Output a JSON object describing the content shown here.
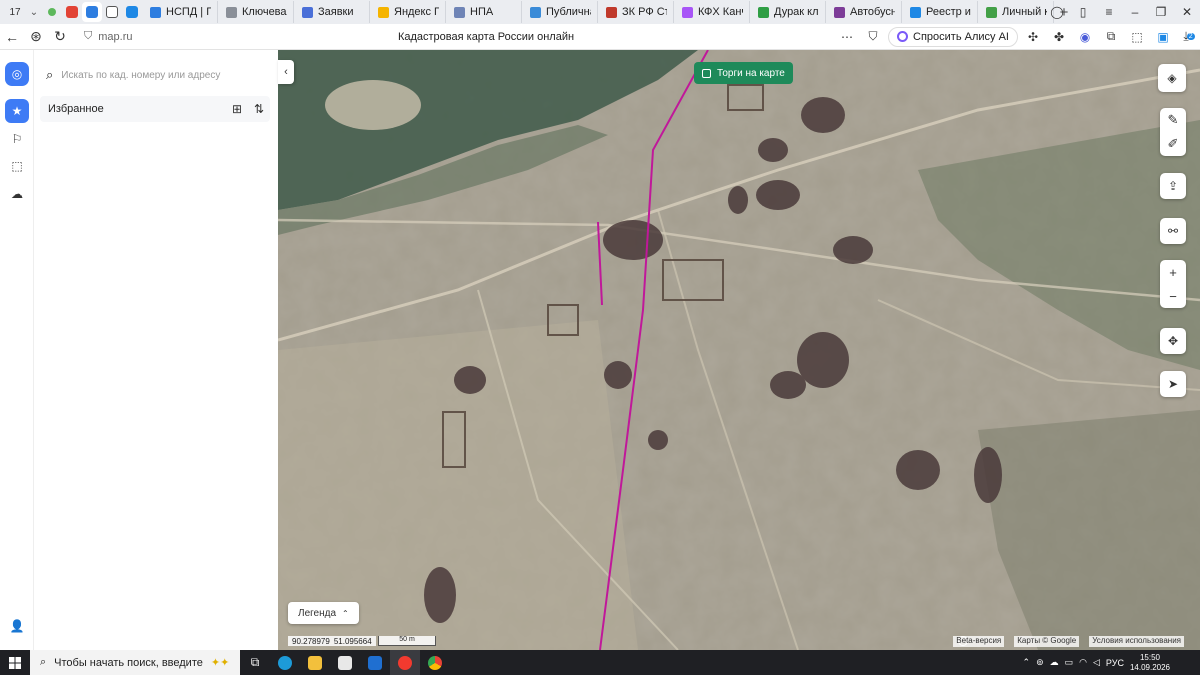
{
  "browser": {
    "tab_count": "17",
    "tabs": [
      {
        "title": "НСПД | Гео",
        "color": "#2d7de0"
      },
      {
        "title": "Ключевая с",
        "color": "#8a8f98"
      },
      {
        "title": "Заявки",
        "color": "#4a6fd8"
      },
      {
        "title": "Яндекс По",
        "color": "#f5b400"
      },
      {
        "title": "НПА",
        "color": "#6f84b6"
      },
      {
        "title": "Публичная",
        "color": "#3a8bd8"
      },
      {
        "title": "ЗК РФ Стат",
        "color": "#c0392b"
      },
      {
        "title": "КФХ Канчь",
        "color": "#a855f7"
      },
      {
        "title": "Дурак клас",
        "color": "#2f9e44"
      },
      {
        "title": "Автобусна",
        "color": "#7d3c98"
      },
      {
        "title": "Реестр изв",
        "color": "#1e88e5"
      },
      {
        "title": "Личный ка",
        "color": "#43a047"
      }
    ],
    "new_tab": "+",
    "url": "map.ru",
    "page_title": "Кадастровая карта России онлайн",
    "alisa": "Спросить Алису AI",
    "download_badge": "2"
  },
  "sidebar": {
    "search_placeholder": "Искать по кад. номеру или адресу",
    "favorites_label": "Избранное"
  },
  "map": {
    "torgi_label": "Торги на карте",
    "legend_label": "Легенда",
    "coord_lon": "90.278979",
    "coord_lat": "51.095664",
    "scale_label": "50 m",
    "beta_label": "Beta-версия",
    "attribution": "Карты © Google",
    "terms": "Условия использования",
    "boundary_color": "#c0189a"
  },
  "taskbar": {
    "search_placeholder": "Чтобы начать поиск, введите",
    "language": "РУС",
    "time": "15:50",
    "date": "14.09.2026"
  }
}
